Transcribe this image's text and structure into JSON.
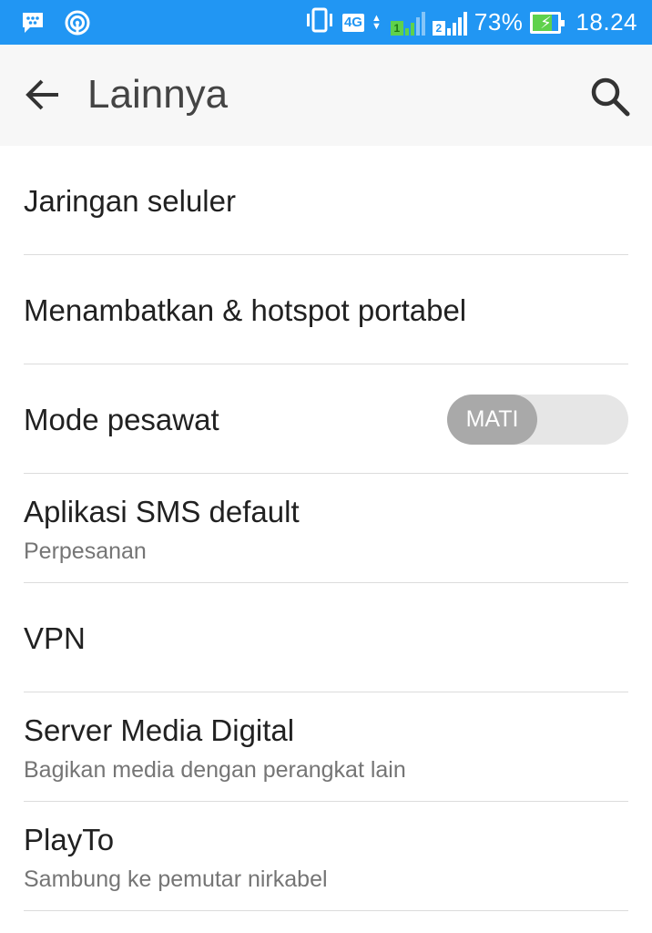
{
  "status_bar": {
    "left_icons": [
      "bbm-icon",
      "hotspot-icon"
    ],
    "network_type": "4G",
    "sim1_label": "1",
    "sim2_label": "2",
    "battery_percent": "73%",
    "battery_level": 0.73,
    "time": "18.24",
    "colors": {
      "background": "#2196f3",
      "sim_active": "#5fd14c"
    }
  },
  "toolbar": {
    "title": "Lainnya",
    "back_icon": "arrow-left-icon",
    "search_icon": "search-icon"
  },
  "items": [
    {
      "label": "Jaringan seluler"
    },
    {
      "label": "Menambatkan & hotspot portabel"
    },
    {
      "label": "Mode pesawat",
      "toggle_label": "MATI",
      "toggle_on": false
    },
    {
      "label": "Aplikasi SMS default",
      "summary": "Perpesanan"
    },
    {
      "label": "VPN"
    },
    {
      "label": "Server Media Digital",
      "summary": "Bagikan media dengan perangkat lain"
    },
    {
      "label": "PlayTo",
      "summary": "Sambung ke pemutar nirkabel"
    }
  ]
}
